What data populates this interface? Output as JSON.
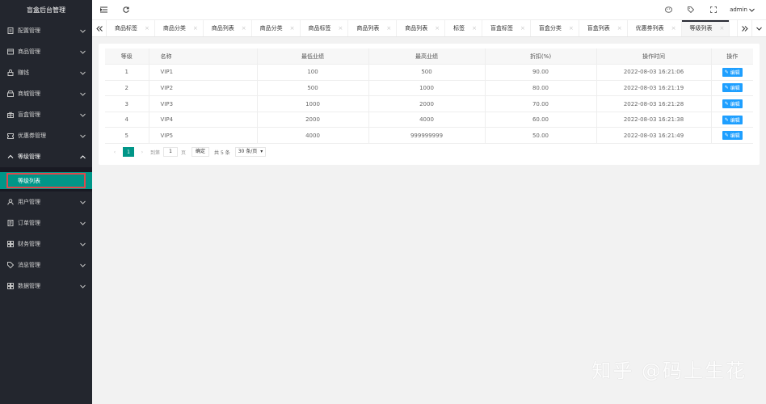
{
  "app": {
    "title": "盲盒后台管理"
  },
  "colors": {
    "sidebar_bg": "#23262e",
    "accent": "#009688",
    "edit_button": "#1e9fff",
    "highlight_border": "#e0474c"
  },
  "sidebar": {
    "items": [
      {
        "label": "配置管理",
        "icon": "document-icon"
      },
      {
        "label": "商品管理",
        "icon": "box-icon"
      },
      {
        "label": "赚钱",
        "icon": "lock-icon"
      },
      {
        "label": "商城管理",
        "icon": "shop-icon"
      },
      {
        "label": "盲盒管理",
        "icon": "gift-icon"
      },
      {
        "label": "优惠券管理",
        "icon": "coupon-icon"
      },
      {
        "label": "等级管理",
        "icon": "caret-up-icon"
      }
    ],
    "sub_item": {
      "label": "等级列表"
    },
    "items_after": [
      {
        "label": "用户管理",
        "icon": "user-icon"
      },
      {
        "label": "订单管理",
        "icon": "order-icon"
      },
      {
        "label": "财务管理",
        "icon": "grid-icon"
      },
      {
        "label": "消息管理",
        "icon": "tag-icon"
      },
      {
        "label": "数据管理",
        "icon": "grid-icon"
      }
    ]
  },
  "header": {
    "user": "admin"
  },
  "tabs": [
    {
      "label": "商品标签",
      "closable": true
    },
    {
      "label": "商品分类",
      "closable": true
    },
    {
      "label": "商品列表",
      "closable": true
    },
    {
      "label": "商品分类",
      "closable": true
    },
    {
      "label": "商品标签",
      "closable": true
    },
    {
      "label": "商品列表",
      "closable": true
    },
    {
      "label": "商品列表",
      "closable": true
    },
    {
      "label": "标签",
      "closable": true
    },
    {
      "label": "盲盒标签",
      "closable": true
    },
    {
      "label": "盲盒分类",
      "closable": true
    },
    {
      "label": "盲盒列表",
      "closable": true
    },
    {
      "label": "优惠券列表",
      "closable": true
    },
    {
      "label": "等级列表",
      "closable": true,
      "active": true
    }
  ],
  "table": {
    "headers": [
      "等级",
      "名称",
      "最低业绩",
      "最高业绩",
      "折扣(%)",
      "操作时间",
      "操作"
    ],
    "rows": [
      {
        "level": "1",
        "name": "VIP1",
        "min": "100",
        "max": "500",
        "discount": "90.00",
        "time": "2022-08-03 16:21:06"
      },
      {
        "level": "2",
        "name": "VIP2",
        "min": "500",
        "max": "1000",
        "discount": "80.00",
        "time": "2022-08-03 16:21:19"
      },
      {
        "level": "3",
        "name": "VIP3",
        "min": "1000",
        "max": "2000",
        "discount": "70.00",
        "time": "2022-08-03 16:21:28"
      },
      {
        "level": "4",
        "name": "VIP4",
        "min": "2000",
        "max": "4000",
        "discount": "60.00",
        "time": "2022-08-03 16:21:38"
      },
      {
        "level": "5",
        "name": "VIP5",
        "min": "4000",
        "max": "999999999",
        "discount": "50.00",
        "time": "2022-08-03 16:21:49"
      }
    ],
    "edit_label": "编辑"
  },
  "pager": {
    "current": "1",
    "goto_label": "到第",
    "goto_value": "1",
    "page_unit": "页",
    "confirm": "确定",
    "total": "共 5 条",
    "per_page": "30 条/页"
  },
  "watermark": "知乎 @码上生花"
}
